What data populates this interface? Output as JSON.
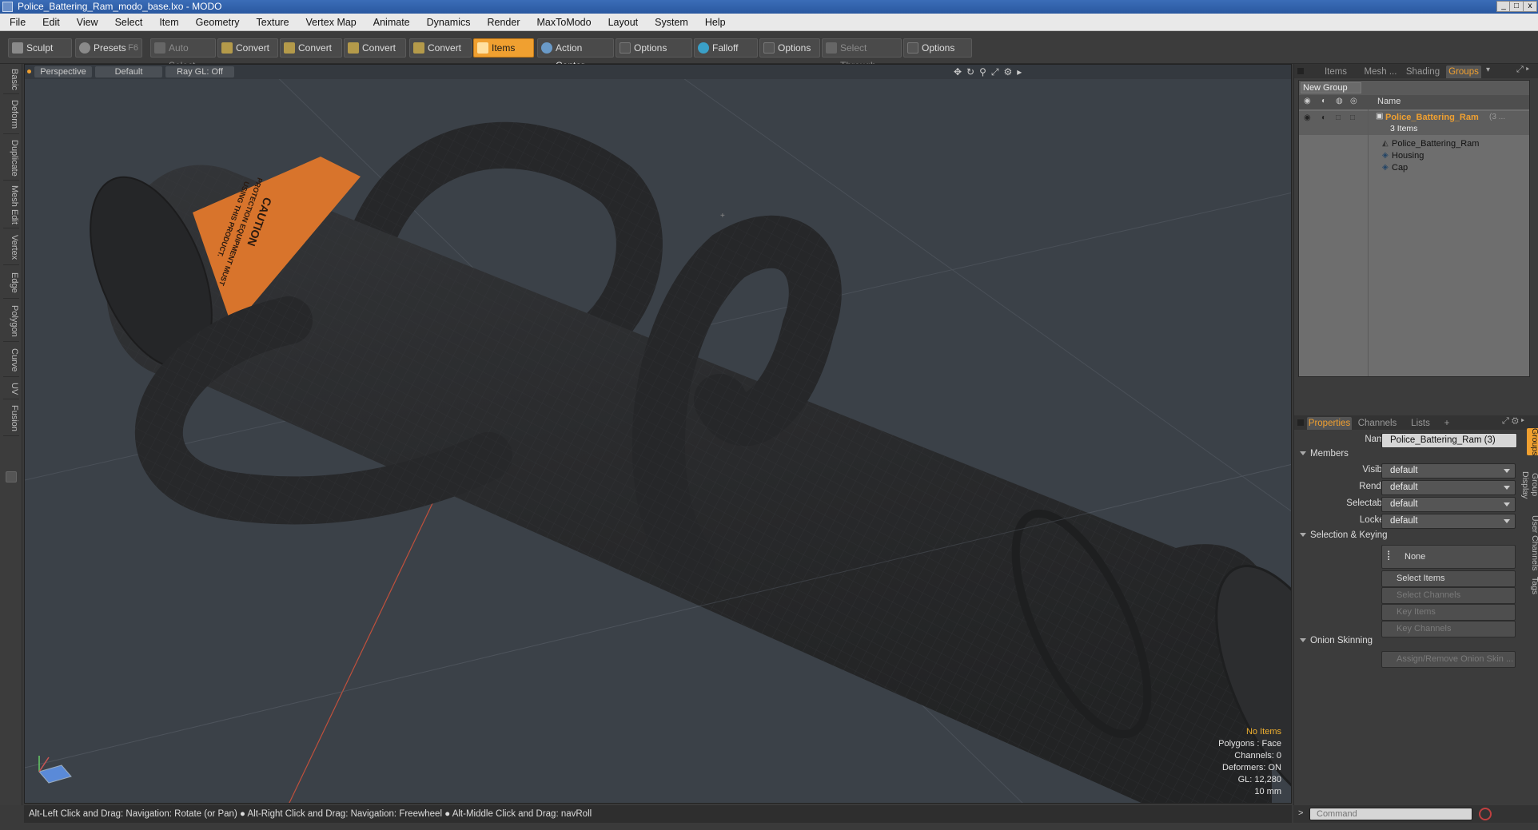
{
  "window": {
    "title": "Police_Battering_Ram_modo_base.lxo - MODO",
    "buttons": {
      "minimize": "_",
      "maximize": "□",
      "close": "x"
    }
  },
  "menu": [
    "File",
    "Edit",
    "View",
    "Select",
    "Item",
    "Geometry",
    "Texture",
    "Vertex Map",
    "Animate",
    "Dynamics",
    "Render",
    "MaxToModo",
    "Layout",
    "System",
    "Help"
  ],
  "toolbar": {
    "sculpt": "Sculpt",
    "presets": "Presets",
    "presets_key": "F6",
    "auto_select": "Auto Select",
    "convert1": "Convert",
    "convert2": "Convert",
    "convert3": "Convert",
    "convert4": "Convert",
    "items": "Items",
    "action_center": "Action Center",
    "options1": "Options",
    "falloff": "Falloff",
    "options2": "Options",
    "select_through": "Select Through",
    "options3": "Options"
  },
  "left_tabs": [
    "Basic",
    "Deform",
    "Duplicate",
    "Mesh Edit",
    "Vertex",
    "Edge",
    "Polygon",
    "Curve",
    "UV",
    "Fusion"
  ],
  "viewport": {
    "view": "Perspective",
    "shading": "Default",
    "raygl": "Ray GL: Off",
    "hud": {
      "selection": "No Items",
      "polygons": "Polygons : Face",
      "channels": "Channels: 0",
      "deformers": "Deformers: ON",
      "gl": "GL: 12,280",
      "scale": "10 mm"
    },
    "label_text": [
      "CAUTION",
      "PROTECTION EQUIPMENT MUST",
      "USING THIS PRODUCT."
    ]
  },
  "status_bar": "Alt-Left Click and Drag: Navigation: Rotate (or Pan) ● Alt-Right Click and Drag: Navigation: Freewheel ● Alt-Middle Click and Drag: navRoll",
  "groups_panel": {
    "tabs": [
      "Items",
      "Mesh ...",
      "Shading",
      "Groups"
    ],
    "active_tab": "Groups",
    "new_group": "New Group",
    "column_name": "Name",
    "group_name": "Police_Battering_Ram",
    "group_suffix": "(3 ...",
    "group_count": "3 Items",
    "children": [
      "Police_Battering_Ram",
      "Housing",
      "Cap"
    ]
  },
  "properties_panel": {
    "tabs": [
      "Properties",
      "Channels",
      "Lists",
      "+"
    ],
    "active_tab": "Properties",
    "name_label": "Name",
    "name_value": "Police_Battering_Ram (3)",
    "members_section": "Members",
    "members": [
      {
        "label": "Visible",
        "value": "default"
      },
      {
        "label": "Render",
        "value": "default"
      },
      {
        "label": "Selectable",
        "value": "default"
      },
      {
        "label": "Locked",
        "value": "default"
      }
    ],
    "selection_section": "Selection & Keying",
    "none_button": "None",
    "select_items": "Select Items",
    "select_channels": "Select Channels",
    "key_items": "Key Items",
    "key_channels": "Key Channels",
    "onion_section": "Onion Skinning",
    "onion_button": "Assign/Remove Onion Skin ...",
    "side_tabs": [
      "Groups",
      "Group Display",
      "User Channels",
      "Tags"
    ]
  },
  "command": {
    "prompt": ">",
    "placeholder": "Command"
  },
  "colors": {
    "accent": "#f0a030",
    "viewport_bg": "#3b4148",
    "label_orange": "#d8742c"
  }
}
